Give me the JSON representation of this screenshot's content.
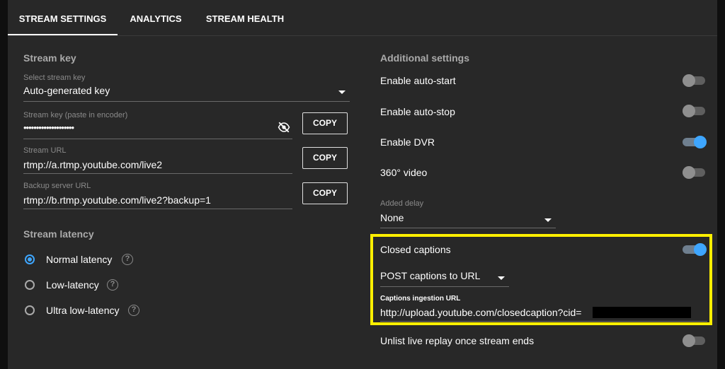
{
  "tabs": [
    {
      "label": "STREAM SETTINGS",
      "active": true
    },
    {
      "label": "ANALYTICS",
      "active": false
    },
    {
      "label": "STREAM HEALTH",
      "active": false
    }
  ],
  "stream_key": {
    "section_title": "Stream key",
    "select_label": "Select stream key",
    "select_value": "Auto-generated key",
    "key_label": "Stream key (paste in encoder)",
    "key_value": "••••••••••••••••••••",
    "url_label": "Stream URL",
    "url_value": "rtmp://a.rtmp.youtube.com/live2",
    "backup_label": "Backup server URL",
    "backup_value": "rtmp://b.rtmp.youtube.com/live2?backup=1",
    "copy_label": "COPY"
  },
  "latency": {
    "section_title": "Stream latency",
    "options": [
      {
        "label": "Normal latency",
        "selected": true
      },
      {
        "label": "Low-latency",
        "selected": false
      },
      {
        "label": "Ultra low-latency",
        "selected": false
      }
    ],
    "help_glyph": "?"
  },
  "additional": {
    "section_title": "Additional settings",
    "toggles": [
      {
        "label": "Enable auto-start",
        "on": false
      },
      {
        "label": "Enable auto-stop",
        "on": false
      },
      {
        "label": "Enable DVR",
        "on": true
      },
      {
        "label": "360° video",
        "on": false
      }
    ],
    "delay_label": "Added delay",
    "delay_value": "None",
    "closed_captions_label": "Closed captions",
    "closed_captions_on": true,
    "captions_method": "POST captions to URL",
    "captions_url_label": "Captions ingestion URL",
    "captions_url_value": "http://upload.youtube.com/closedcaption?cid=",
    "unlist_label": "Unlist live replay once stream ends",
    "unlist_on": false
  },
  "colors": {
    "accent": "#3ea6ff",
    "highlight": "#ffef00",
    "background": "#282828"
  }
}
